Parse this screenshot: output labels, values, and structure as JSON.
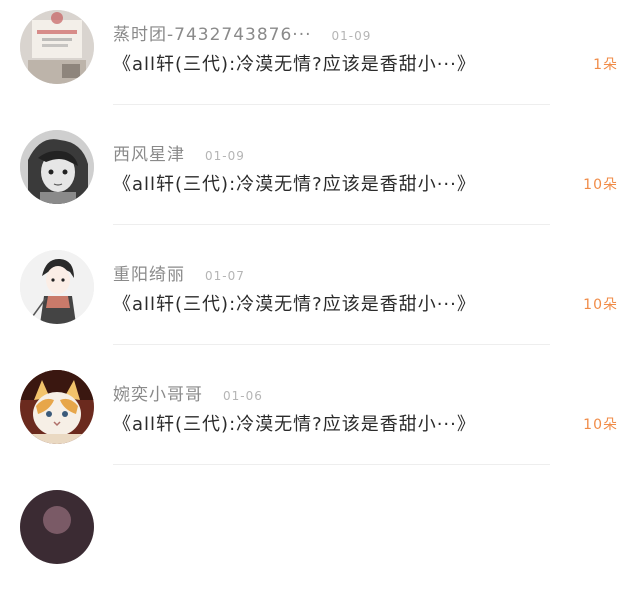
{
  "items": [
    {
      "name": "蒸时团-7432743876···",
      "date": "01-09",
      "message": "《all轩(三代):冷漠无情?应该是香甜小···》",
      "count": "1朵",
      "avatar_icon": "avatar-badge-photo"
    },
    {
      "name": "西风星津",
      "date": "01-09",
      "message": "《all轩(三代):冷漠无情?应该是香甜小···》",
      "count": "10朵",
      "avatar_icon": "avatar-sketch-face"
    },
    {
      "name": "重阳绮丽",
      "date": "01-07",
      "message": "《all轩(三代):冷漠无情?应该是香甜小···》",
      "count": "10朵",
      "avatar_icon": "avatar-anime-boy"
    },
    {
      "name": "婉奕小哥哥",
      "date": "01-06",
      "message": "《all轩(三代):冷漠无情?应该是香甜小···》",
      "count": "10朵",
      "avatar_icon": "avatar-cat"
    }
  ]
}
